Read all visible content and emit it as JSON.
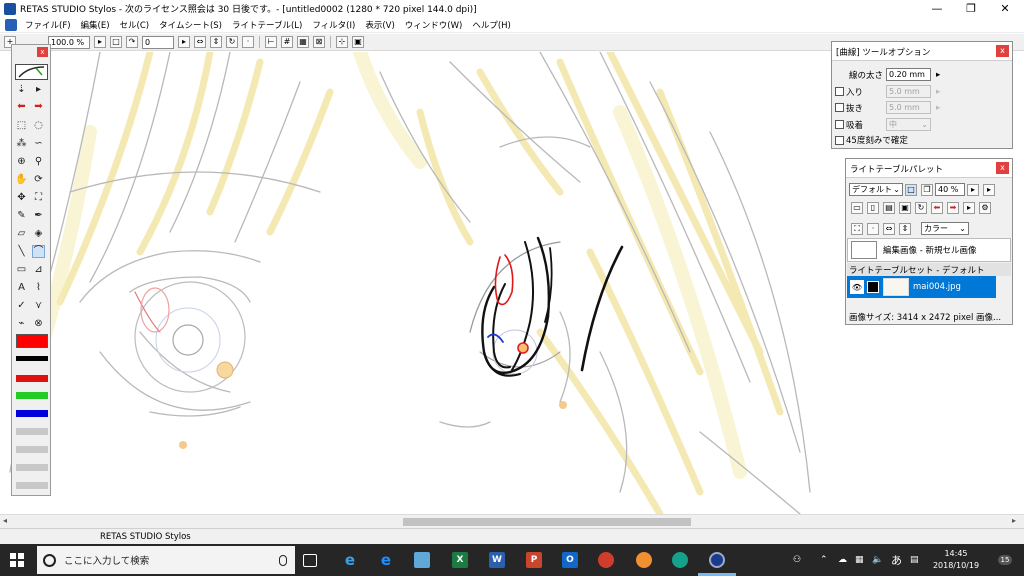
{
  "window": {
    "title": "RETAS STUDIO Stylos - 次のライセンス照会は 30 日後です。- [untitled0002 (1280 * 720 pixel 144.0 dpi)]",
    "minimize": "—",
    "restore": "❐",
    "close": "✕"
  },
  "menu": [
    "ファイル(F)",
    "編集(E)",
    "セル(C)",
    "タイムシート(S)",
    "ライトテーブル(L)",
    "フィルタ(I)",
    "表示(V)",
    "ウィンドウ(W)",
    "ヘルプ(H)"
  ],
  "toolbar": {
    "zoom": "100.0 %",
    "frame": "0"
  },
  "tool_palette": {
    "close": "x",
    "swatches": [
      "#ff0000",
      "#000000",
      "#e01010",
      "#22cc22",
      "#0000dd",
      "#c8c8c8",
      "#c8c8c8",
      "#c8c8c8",
      "#c8c8c8",
      "#c8c8c8"
    ]
  },
  "tool_options": {
    "title": "[曲線] ツールオプション",
    "close": "x",
    "line_width_label": "線の太さ",
    "line_width_value": "0.20 mm",
    "entry_label": "入り",
    "entry_value": "5.0 mm",
    "exit_label": "抜き",
    "exit_value": "5.0 mm",
    "snap_label": "吸着",
    "snap_value": "中",
    "angle_label": "45度刻みで確定"
  },
  "light_table": {
    "title": "ライトテーブルパレット",
    "close": "x",
    "preset": "デフォルト",
    "zoom": "40 %",
    "color_mode": "カラー",
    "edit_image_label": "編集画像 - 新規セル画像",
    "set_label": "ライトテーブルセット - デフォルト",
    "file_name": "mai004.jpg",
    "image_size": "画像サイズ: 3414 x 2472 pixel  画像..."
  },
  "status": {
    "app_name": "RETAS STUDIO Stylos"
  },
  "taskbar": {
    "search_placeholder": "ここに入力して検索",
    "ime": "あ",
    "time": "14:45",
    "date": "2018/10/19",
    "notification_count": "15"
  },
  "colors": {
    "accent_blue": "#0078d7",
    "close_red": "#e04040",
    "taskbar": "#262626"
  }
}
